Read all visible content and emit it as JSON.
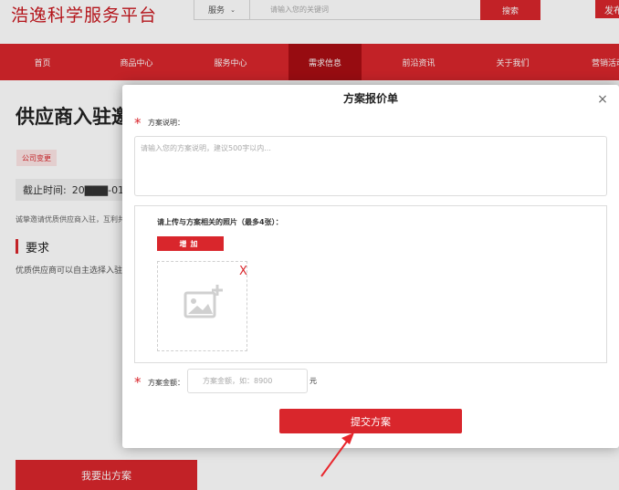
{
  "header": {
    "logo": "浩逸科学服务平台",
    "search_category": "服务",
    "search_placeholder": "请输入您的关键词",
    "search_button": "搜索",
    "right_button": "发布"
  },
  "nav": {
    "items": [
      "首页",
      "商品中心",
      "服务中心",
      "需求信息",
      "前沿资讯",
      "关于我们",
      "营销活动"
    ],
    "active_index": 3
  },
  "page": {
    "title": "供应商入驻邀",
    "tag": "公司变更",
    "deadline_label": "截止时间:",
    "deadline_value": "20▇▇▇-01",
    "intro": "诚挚邀请优质供应商入驻，互利共",
    "section_title": "要求",
    "section_text": "优质供应商可以自主选择入驻",
    "bottom_button": "我要出方案"
  },
  "modal": {
    "title": "方案报价单",
    "close_symbol": "×",
    "desc_label": "方案说明：",
    "desc_placeholder": "请输入您的方案说明，建议500字以内...",
    "upload_label": "请上传与方案相关的照片（最多4张）：",
    "add_button": "增加",
    "remove_symbol": "X",
    "amount_label": "方案金额：",
    "amount_placeholder": "方案金额，如：8900",
    "unit": "元",
    "submit_button": "提交方案",
    "required_mark": "*"
  },
  "colors": {
    "brand_red": "#d9262c",
    "active_nav": "#a90e14"
  }
}
